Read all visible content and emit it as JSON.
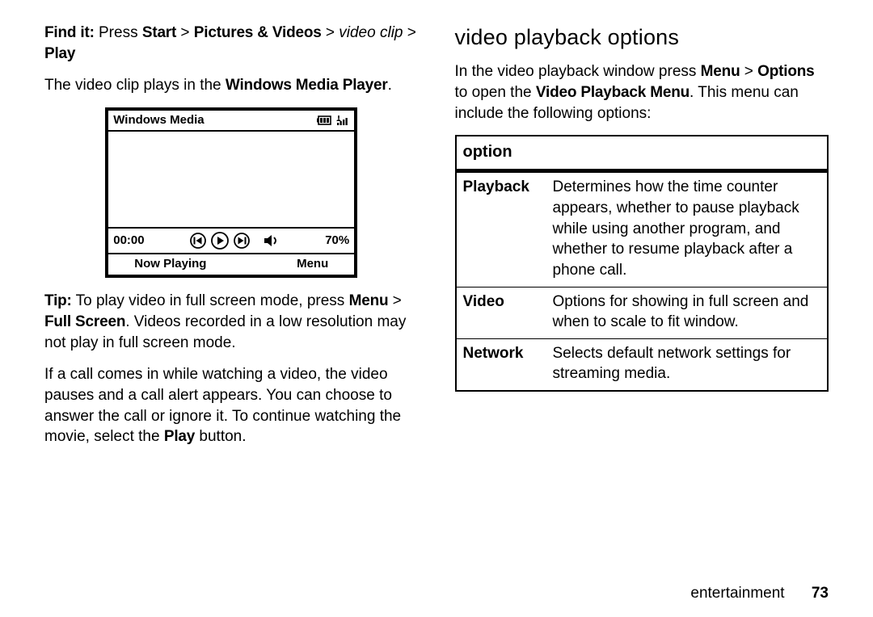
{
  "left": {
    "find_it_label": "Find it:",
    "find_it_press": " Press ",
    "path_start": "Start",
    "gt1": " > ",
    "path_pv": "Pictures & Videos",
    "gt2": " > ",
    "path_clip": "video clip",
    "gt3": " > ",
    "path_play": "Play",
    "plays_in_a": "The video clip plays in the ",
    "plays_in_b": "Windows Media Player",
    "plays_in_c": ".",
    "tip_label": "Tip:",
    "tip_a": " To play video in full screen mode, press ",
    "tip_menu": "Menu",
    "tip_gt": " > ",
    "tip_fs": "Full Screen",
    "tip_b": ". Videos recorded in a low resolution may not play in full screen mode.",
    "call_a": "If a call comes in while watching a video, the video pauses and a call alert appears. You can choose to answer the call or ignore it. To continue watching the movie, select the ",
    "call_play": "Play",
    "call_b": " button."
  },
  "phone": {
    "title": "Windows Media",
    "time": "00:00",
    "volume": "70%",
    "soft_left": "Now Playing",
    "soft_right": "Menu"
  },
  "right": {
    "heading": "video playback options",
    "intro_a": "In the video playback window press ",
    "intro_menu": "Menu",
    "intro_gt": " > ",
    "intro_options": "Options",
    "intro_b": " to open the ",
    "intro_vpm": "Video Playback Menu",
    "intro_c": ". This menu can include the following options:",
    "table_header": "option",
    "rows": [
      {
        "k": "Playback",
        "v": "Determines how the time counter appears, whether to pause playback while using another program, and whether to resume playback after a phone call."
      },
      {
        "k": "Video",
        "v": "Options for showing in full screen and when to scale to fit window."
      },
      {
        "k": "Network",
        "v": "Selects default network settings for streaming media."
      }
    ]
  },
  "footer": {
    "section": "entertainment",
    "page": "73"
  }
}
